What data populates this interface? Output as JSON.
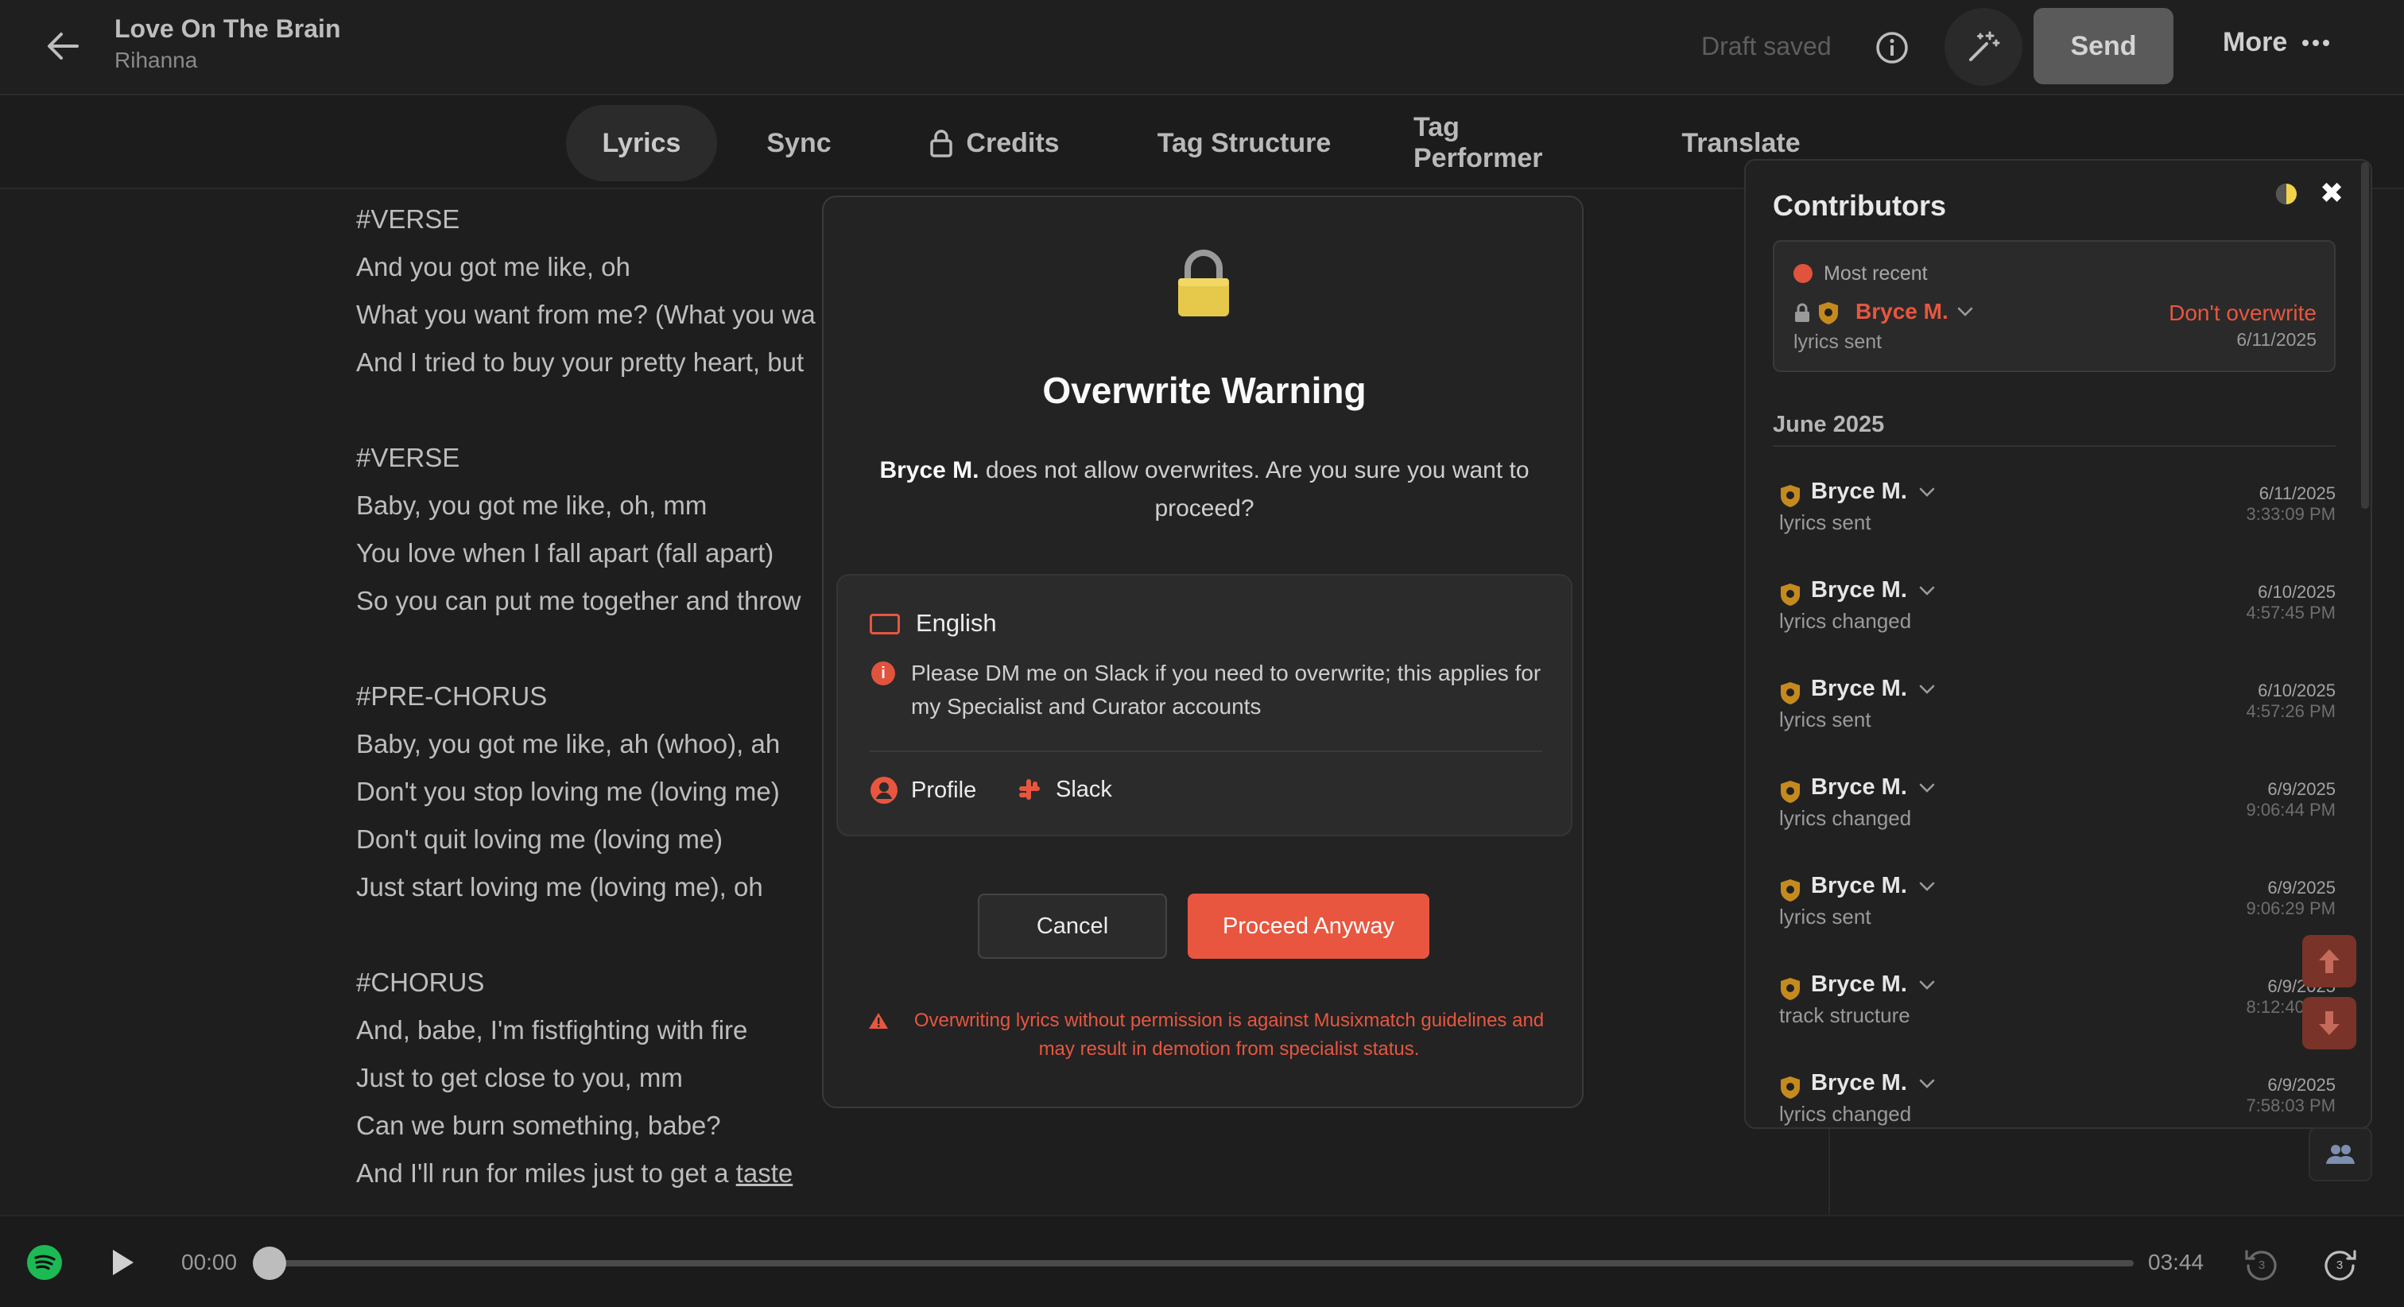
{
  "header": {
    "song_title": "Love On The Brain",
    "artist": "Rihanna",
    "draft_status": "Draft saved",
    "send_label": "Send",
    "more_label": "More"
  },
  "tabs": [
    {
      "label": "Lyrics",
      "active": true
    },
    {
      "label": "Sync"
    },
    {
      "label": "Credits",
      "locked": true
    },
    {
      "label": "Tag Structure"
    },
    {
      "label": "Tag Performer"
    },
    {
      "label": "Translate"
    }
  ],
  "lyrics": [
    {
      "type": "tag",
      "text": "#VERSE"
    },
    {
      "type": "line",
      "text": "And you got me like, oh"
    },
    {
      "type": "line",
      "text": "What you want from me? (What you wa"
    },
    {
      "type": "line",
      "text": "And I tried to buy your pretty heart, but"
    },
    {
      "type": "gap",
      "text": ""
    },
    {
      "type": "tag",
      "text": "#VERSE"
    },
    {
      "type": "line",
      "text": "Baby, you got me like, oh, mm"
    },
    {
      "type": "line",
      "text": "You love when I fall apart (fall apart)"
    },
    {
      "type": "line",
      "text": "So you can put me together and throw"
    },
    {
      "type": "gap",
      "text": ""
    },
    {
      "type": "tag",
      "text": "#PRE-CHORUS"
    },
    {
      "type": "line",
      "text": "Baby, you got me like, ah (whoo), ah"
    },
    {
      "type": "line",
      "text": "Don't you stop loving me (loving me)"
    },
    {
      "type": "line",
      "text": "Don't quit loving me (loving me)"
    },
    {
      "type": "line",
      "text": "Just start loving me (loving me), oh"
    },
    {
      "type": "gap",
      "text": ""
    },
    {
      "type": "tag",
      "text": "#CHORUS"
    },
    {
      "type": "line",
      "text": "And, babe, I'm fistfighting with fire"
    },
    {
      "type": "line",
      "text": "Just to get close to you, mm"
    },
    {
      "type": "line",
      "text": "Can we burn something, babe?"
    },
    {
      "type": "line",
      "text": "And I'll run for miles just to get a ",
      "underlined": "taste"
    }
  ],
  "player": {
    "current_time": "00:00",
    "end_time": "03:44",
    "progress": 0
  },
  "modal": {
    "title": "Overwrite Warning",
    "message_name": "Bryce M.",
    "message_rest": " does not allow overwrites. Are you sure you want to proceed?",
    "language": "English",
    "note": "Please DM me on Slack if you need to overwrite; this applies for my Specialist and Curator accounts",
    "profile_label": "Profile",
    "slack_label": "Slack",
    "cancel_label": "Cancel",
    "proceed_label": "Proceed Anyway",
    "warning": "Overwriting lyrics without permission is against Musixmatch guidelines and may result in demotion from specialist status."
  },
  "contributors": {
    "title": "Contributors",
    "most_recent": {
      "label": "Most recent",
      "name": "Bryce M.",
      "action": "lyrics sent",
      "flag": "Don't overwrite",
      "date": "6/11/2025"
    },
    "month": "June 2025",
    "entries": [
      {
        "name": "Bryce M.",
        "action": "lyrics sent",
        "date": "6/11/2025",
        "time": "3:33:09 PM"
      },
      {
        "name": "Bryce M.",
        "action": "lyrics changed",
        "date": "6/10/2025",
        "time": "4:57:45 PM"
      },
      {
        "name": "Bryce M.",
        "action": "lyrics sent",
        "date": "6/10/2025",
        "time": "4:57:26 PM"
      },
      {
        "name": "Bryce M.",
        "action": "lyrics changed",
        "date": "6/9/2025",
        "time": "9:06:44 PM"
      },
      {
        "name": "Bryce M.",
        "action": "lyrics sent",
        "date": "6/9/2025",
        "time": "9:06:29 PM"
      },
      {
        "name": "Bryce M.",
        "action": "track structure",
        "date": "6/9/2025",
        "time": "8:12:40 PM"
      },
      {
        "name": "Bryce M.",
        "action": "lyrics changed",
        "date": "6/9/2025",
        "time": "7:58:03 PM"
      }
    ]
  },
  "colors": {
    "accent": "#e8563f",
    "background": "#1e1e1e",
    "shield": "#c58a1e"
  }
}
